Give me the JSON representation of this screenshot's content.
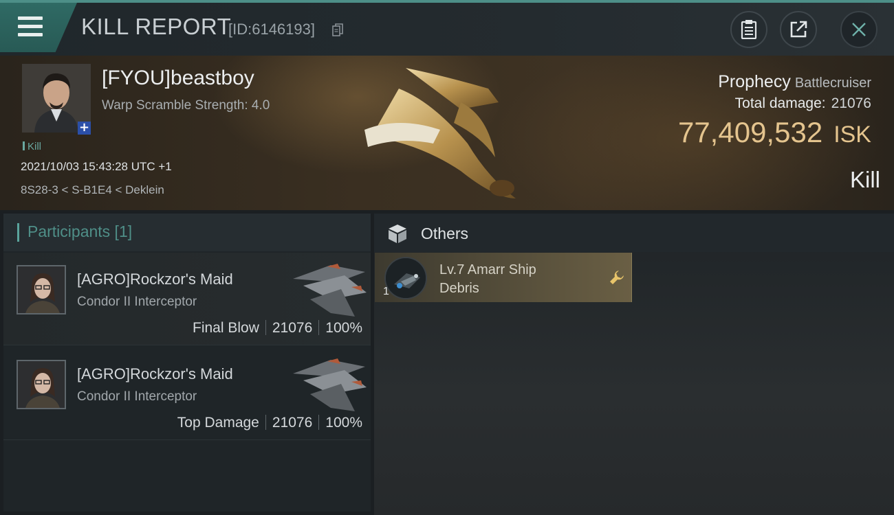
{
  "header": {
    "title": "KILL REPORT",
    "report_id": "[ID:6146193]",
    "menu_icon": "hamburger-menu-icon",
    "buttons": [
      "clipboard-icon",
      "share-icon",
      "close-icon"
    ],
    "accent_color": "#4d8f88"
  },
  "victim": {
    "name": "[FYOU]beastboy",
    "warp_scramble": "Warp Scramble Strength: 4.0",
    "result_tag": "Kill",
    "datetime": "2021/10/03 15:43:28 UTC +1",
    "location": "8S28-3 < S-B1E4 < Deklein",
    "ship_name": "Prophecy",
    "ship_class": "Battlecruiser",
    "total_damage_label": "Total damage:",
    "total_damage": "21076",
    "isk_value": "77,409,532",
    "isk_unit": "ISK",
    "result": "Kill",
    "isk_color": "#e4c48e"
  },
  "participants": {
    "header": "Participants [1]",
    "rows": [
      {
        "name": "[AGRO]Rockzor's Maid",
        "ship": "Condor II Interceptor",
        "role": "Final Blow",
        "damage": "21076",
        "percent": "100%"
      },
      {
        "name": "[AGRO]Rockzor's Maid",
        "ship": "Condor II Interceptor",
        "role": "Top Damage",
        "damage": "21076",
        "percent": "100%"
      }
    ]
  },
  "others": {
    "header": "Others",
    "items": [
      {
        "name": "Lv.7 Amarr Ship Debris",
        "quantity": "1",
        "action_icon": "wrench-icon"
      }
    ]
  }
}
